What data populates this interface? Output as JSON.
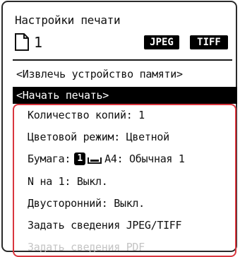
{
  "header": {
    "title": "Настройки печати",
    "copies": "1",
    "formats": [
      "JPEG",
      "TIFF"
    ]
  },
  "menu": {
    "eject": "<Извлечь устройство памяти>",
    "start": "<Начать печать>"
  },
  "settings": {
    "copies": "Количество копий: 1",
    "color_mode": "Цветовой режим: Цветной",
    "paper_label": "Бумага:",
    "paper_tray": "1",
    "paper_value": "A4: Обычная 1",
    "n_on_1": "N на 1: Выкл.",
    "duplex": "Двусторонний: Выкл.",
    "jpeg_tiff": "Задать сведения JPEG/TIFF",
    "pdf": "Задать сведения PDF"
  },
  "colors": {
    "highlight_border": "#d9363e",
    "selection": "#000000",
    "disabled_text": "#c4c4c4"
  },
  "icons": {
    "document": "document-icon",
    "tray": "paper-tray-icon"
  }
}
